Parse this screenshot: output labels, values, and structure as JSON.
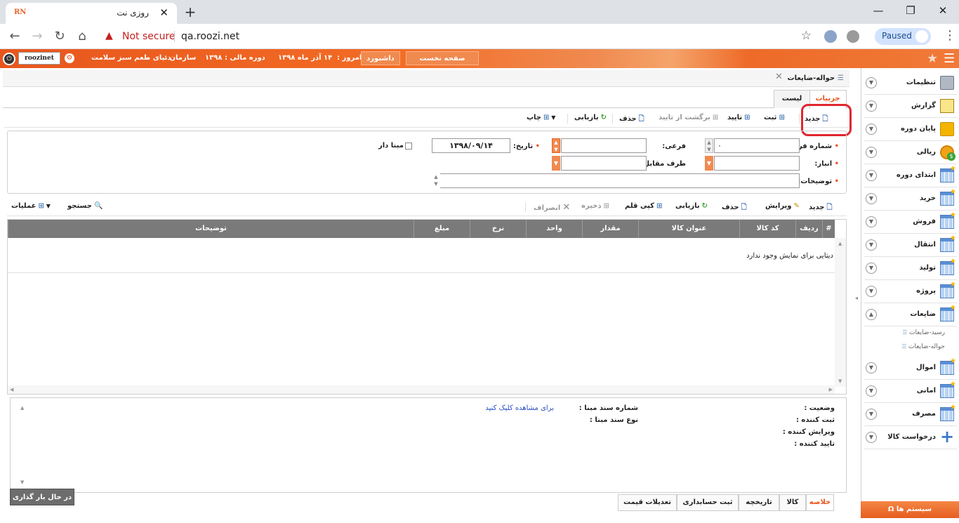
{
  "browser": {
    "tab_title": "روزی نت",
    "favicon_text": "RN",
    "security_label": "Not secure",
    "url": "qa.roozi.net",
    "profile_label": "Paused"
  },
  "header": {
    "username": "roozinet",
    "org_label": "سازمان :",
    "org_value": "دنیای طعم سبز سلامت",
    "fiscal_label": "دوره مالی :",
    "fiscal_value": "۱۳۹۸",
    "today_label": "امروز :",
    "today_value": "۱۴ آذر ماه ۱۳۹۸",
    "dashboard": "داشبورد",
    "home": "صفحه نخست"
  },
  "sidebar": {
    "items": [
      {
        "label": "تنظیمات",
        "icon": "settings-icon"
      },
      {
        "label": "گزارش",
        "icon": "report-icon"
      },
      {
        "label": "پایان دوره",
        "icon": "folder-icon"
      },
      {
        "label": "ریالی",
        "icon": "coin-icon"
      },
      {
        "label": "ابتدای دوره",
        "icon": "grid-star-icon"
      },
      {
        "label": "خرید",
        "icon": "grid-star-icon"
      },
      {
        "label": "فروش",
        "icon": "grid-star-icon"
      },
      {
        "label": "انتقال",
        "icon": "grid-star-icon"
      },
      {
        "label": "تولید",
        "icon": "grid-star-icon"
      },
      {
        "label": "پروژه",
        "icon": "grid-star-icon"
      },
      {
        "label": "ضایعات",
        "icon": "grid-star-icon"
      },
      {
        "label": "اموال",
        "icon": "grid-star-icon"
      },
      {
        "label": "امانی",
        "icon": "grid-star-icon"
      },
      {
        "label": "مصرف",
        "icon": "grid-star-icon"
      },
      {
        "label": "درخواست کالا",
        "icon": "plus-icon"
      }
    ],
    "subitems": [
      "رسید-ضایعات",
      "حواله-ضایعات"
    ],
    "system_button": "سیستم ها"
  },
  "page": {
    "breadcrumb": "حواله-ضایعات",
    "tabs": [
      "جزییات",
      "لیست"
    ]
  },
  "toolbar": {
    "new": "جدید",
    "save": "ثبت",
    "approve": "تایید",
    "unapprove": "برگشت از تایید",
    "delete": "حذف",
    "refresh": "بازیابی",
    "print": "چاپ"
  },
  "form": {
    "form_number_label": "شماره فرم:",
    "form_number_value": "۰",
    "sub_label": "فرعی:",
    "date_label": "تاریخ:",
    "date_value": "۱۳۹۸/۰۹/۱۴",
    "base_label": "مبنا دار",
    "warehouse_label": "انبار:",
    "counterparty_label": "طرف مقابل:",
    "description_label": "توضیحات:"
  },
  "grid_toolbar": {
    "new": "جدید",
    "edit": "ویرایش",
    "delete": "حذف",
    "refresh": "بازیابی",
    "copy": "کپی قلم",
    "save": "ذخیره",
    "cancel": "انصراف",
    "search": "جستجو",
    "operations": "عملیات"
  },
  "grid": {
    "columns": [
      "#",
      "ردیف",
      "کد کالا",
      "عنوان کالا",
      "مقدار",
      "واحد",
      "نرخ",
      "مبلغ",
      "توضیحات"
    ],
    "empty_message": "دیتایی برای نمایش وجود ندارد"
  },
  "details": {
    "status_label": "وضعیت :",
    "creator_label": "ثبت کننده :",
    "editor_label": "ویرایش کننده :",
    "approver_label": "تایید کننده :",
    "base_doc_number_label": "شماره سند مبنا :",
    "base_doc_type_label": "نوع سند مبنا :",
    "view_link": "برای مشاهده کلیک کنید"
  },
  "bottom_tabs": [
    "خلاصه",
    "کالا",
    "تاریخچه",
    "ثبت حسابداری",
    "تعدیلات قیمت"
  ],
  "loading_text": "در حال بار گذاری ..."
}
